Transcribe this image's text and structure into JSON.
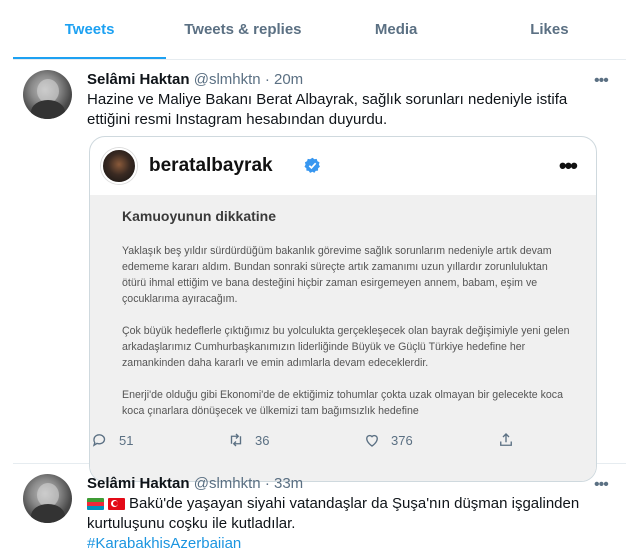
{
  "tabs": [
    "Tweets",
    "Tweets & replies",
    "Media",
    "Likes"
  ],
  "tweet1": {
    "name": "Selâmi Haktan",
    "handle": "@slmhktn",
    "dot": "·",
    "time": "20m",
    "text": "Hazine ve Maliye Bakanı Berat Albayrak, sağlık sorunları nedeniyle istifa ettiğini resmi Instagram hesabından duyurdu.",
    "card": {
      "account": "beratalbayrak",
      "doc_title": "Kamuoyunun dikkatine",
      "paragraphs": [
        "Yaklaşık beş yıldır sürdürdüğüm bakanlık görevime sağlık sorunlarım nedeniyle artık devam edememe kararı aldım. Bundan sonraki süreçte artık zamanımı uzun yıllardır zorunluluktan ötürü ihmal ettiğim ve bana desteğini hiçbir zaman esirgemeyen annem, babam, eşim ve çocuklarıma ayıracağım.",
        "Çok büyük hedeflerle çıktığımız bu yolculukta gerçekleşecek olan bayrak değişimiyle yeni gelen arkadaşlarımız Cumhurbaşkanımızın liderliğinde Büyük ve Güçlü Türkiye hedefine her zamankinden daha kararlı ve emin adımlarla devam edeceklerdir.",
        "Enerji'de olduğu gibi Ekonomi'de de ektiğimiz tohumlar çokta uzak olmayan bir gelecekte koca koca çınarlara dönüşecek ve ülkemizi tam bağımsızlık hedefine"
      ]
    },
    "actions": {
      "replies": "51",
      "retweets": "36",
      "likes": "376"
    }
  },
  "tweet2": {
    "name": "Selâmi Haktan",
    "handle": "@slmhktn",
    "dot": "·",
    "time": "33m",
    "text": "Bakü'de yaşayan siyahi vatandaşlar da Şuşa'nın düşman işgalinden kurtuluşunu coşku ile kutladılar.",
    "hashtag": "#KarabakhisAzerbaijan"
  },
  "colors": {
    "accent": "#1da1f2",
    "muted": "#5b7083",
    "link": "#1b95e0"
  },
  "icons": [
    "more-icon",
    "verified-icon",
    "reply-icon",
    "retweet-icon",
    "like-icon",
    "share-icon",
    "azerbaijan-flag-icon",
    "turkey-flag-icon"
  ]
}
